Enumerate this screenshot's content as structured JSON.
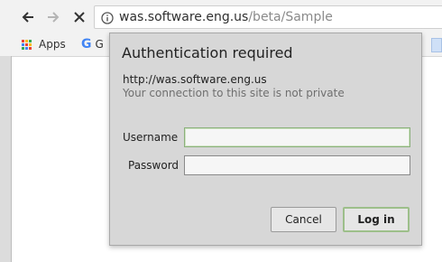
{
  "browser": {
    "url_host": "was.software.eng.us",
    "url_path": "/beta/Sample",
    "bookmarks": [
      {
        "label": "Apps",
        "icon": "apps-grid-icon"
      },
      {
        "label": "G",
        "icon": "google-icon"
      }
    ],
    "apps_colors": [
      "#ea4335",
      "#fbbc05",
      "#34a853",
      "#4285f4",
      "#ea4335",
      "#fbbc05",
      "#34a853",
      "#4285f4",
      "#ea4335"
    ]
  },
  "dialog": {
    "title": "Authentication required",
    "host": "http://was.software.eng.us",
    "warning": "Your connection to this site is not private",
    "username_label": "Username",
    "username_value": "",
    "password_label": "Password",
    "password_value": "",
    "cancel_label": "Cancel",
    "login_label": "Log in"
  }
}
